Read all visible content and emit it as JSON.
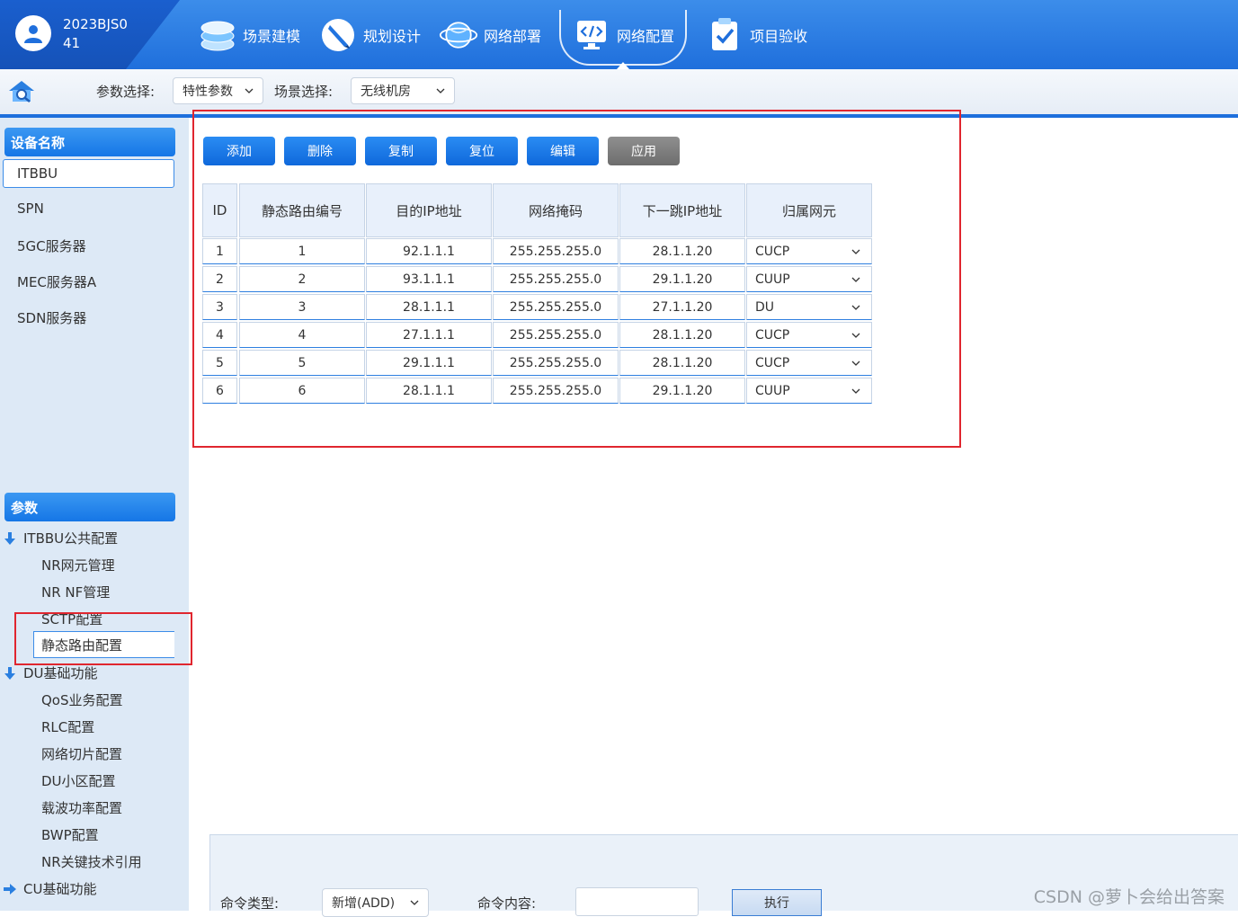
{
  "user": {
    "id": "2023BJS041"
  },
  "nav": [
    {
      "label": "场景建模",
      "icon": "stack-icon"
    },
    {
      "label": "规划设计",
      "icon": "pen-icon"
    },
    {
      "label": "网络部署",
      "icon": "globe-icon"
    },
    {
      "label": "网络配置",
      "icon": "code-monitor-icon",
      "active": true
    },
    {
      "label": "项目验收",
      "icon": "checklist-icon"
    }
  ],
  "toolbar": {
    "param_label": "参数选择:",
    "param_value": "特性参数",
    "scene_label": "场景选择:",
    "scene_value": "无线机房"
  },
  "sidebar": {
    "device_header": "设备名称",
    "devices": [
      "ITBBU",
      "SPN",
      "5GC服务器",
      "MEC服务器A",
      "SDN服务器"
    ],
    "selected_device": "ITBBU",
    "param_header": "参数",
    "tree": [
      {
        "label": "ITBBU公共配置",
        "expanded": true,
        "children": [
          "NR网元管理",
          "NR NF管理",
          "SCTP配置",
          "静态路由配置"
        ]
      },
      {
        "label": "DU基础功能",
        "expanded": true,
        "children": [
          "QoS业务配置",
          "RLC配置",
          "网络切片配置",
          "DU小区配置",
          "载波功率配置",
          "BWP配置",
          "NR关键技术引用"
        ]
      },
      {
        "label": "CU基础功能",
        "expanded": false,
        "children": []
      }
    ],
    "selected_leaf": "静态路由配置"
  },
  "actions": {
    "add": "添加",
    "delete": "删除",
    "copy": "复制",
    "reset": "复位",
    "edit": "编辑",
    "apply": "应用"
  },
  "table": {
    "headers": [
      "ID",
      "静态路由编号",
      "目的IP地址",
      "网络掩码",
      "下一跳IP地址",
      "归属网元"
    ],
    "rows": [
      [
        "1",
        "1",
        "92.1.1.1",
        "255.255.255.0",
        "28.1.1.20",
        "CUCP"
      ],
      [
        "2",
        "2",
        "93.1.1.1",
        "255.255.255.0",
        "29.1.1.20",
        "CUUP"
      ],
      [
        "3",
        "3",
        "28.1.1.1",
        "255.255.255.0",
        "27.1.1.20",
        "DU"
      ],
      [
        "4",
        "4",
        "27.1.1.1",
        "255.255.255.0",
        "28.1.1.20",
        "CUCP"
      ],
      [
        "5",
        "5",
        "29.1.1.1",
        "255.255.255.0",
        "28.1.1.20",
        "CUCP"
      ],
      [
        "6",
        "6",
        "28.1.1.1",
        "255.255.255.0",
        "29.1.1.20",
        "CUUP"
      ]
    ]
  },
  "command": {
    "type_label": "命令类型:",
    "type_value": "新增(ADD)",
    "content_label": "命令内容:",
    "content_value": "",
    "execute": "执行"
  },
  "watermark": "CSDN @萝卜会给出答案",
  "colors": {
    "accent": "#1576e6",
    "highlight": "#e0262f",
    "sidebar_bg": "#dde9f6"
  }
}
